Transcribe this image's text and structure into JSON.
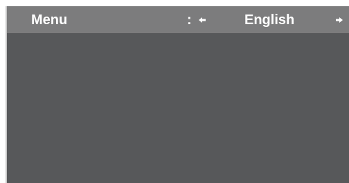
{
  "menu": {
    "label": "Menu",
    "separator": ":",
    "prev_icon": "arrow-left-icon",
    "value": "English",
    "next_icon": "arrow-right-icon"
  },
  "colors": {
    "bar_background": "#7c7c7d",
    "screen_background": "#57585a",
    "text": "#ffffff"
  }
}
